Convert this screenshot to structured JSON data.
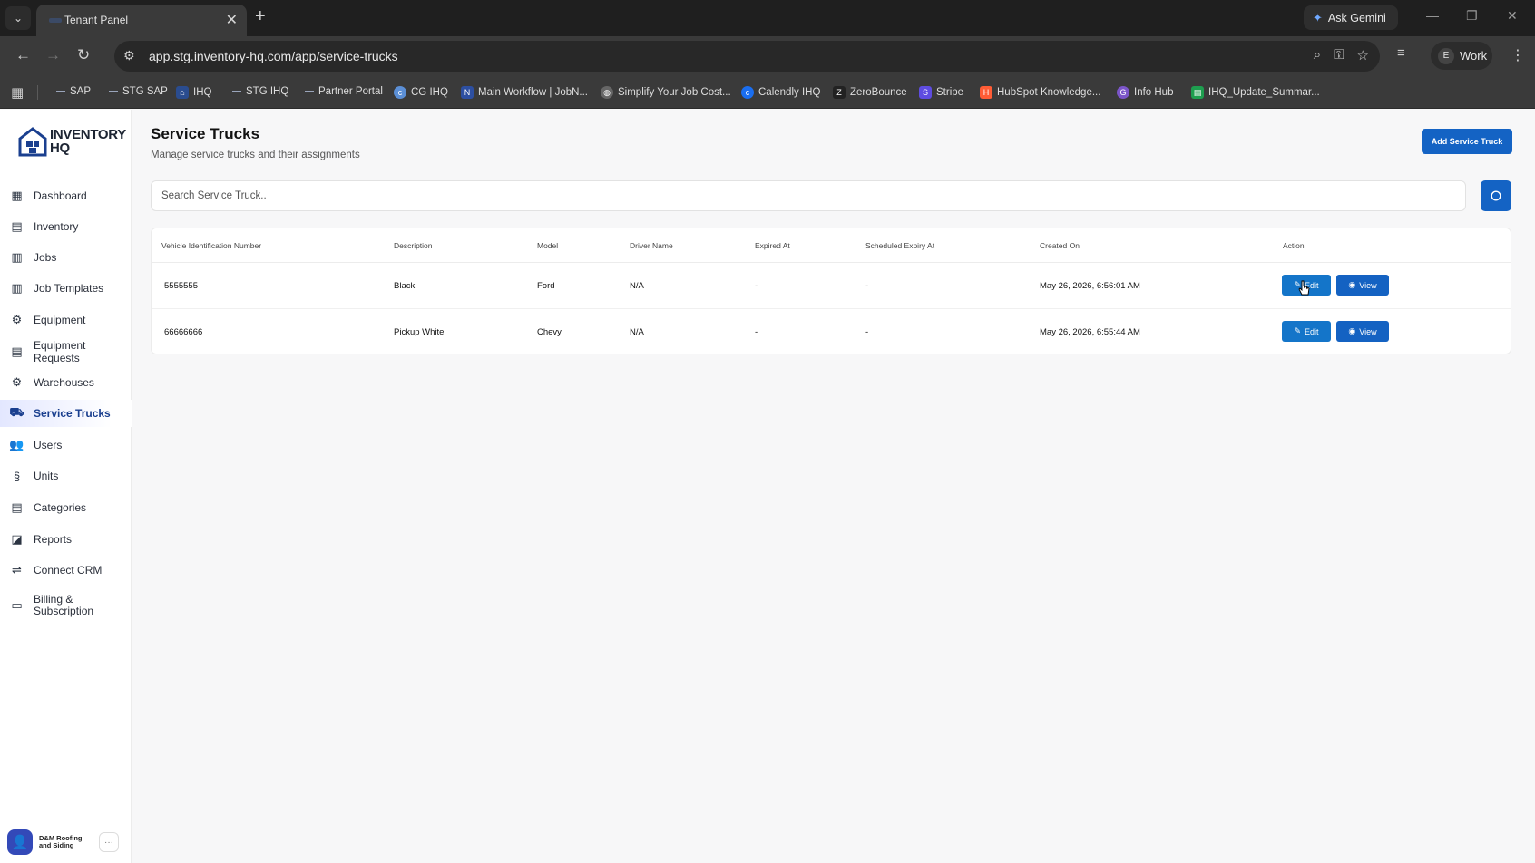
{
  "browser": {
    "tab_title": "Tenant Panel",
    "url": "app.stg.inventory-hq.com/app/service-trucks",
    "gemini_label": "Ask Gemini",
    "profile_initial": "E",
    "profile_label": "Work",
    "bookmarks": [
      {
        "label": "SAP",
        "icon": "dash"
      },
      {
        "label": "STG SAP",
        "icon": "dash"
      },
      {
        "label": "IHQ",
        "icon": "house"
      },
      {
        "label": "STG IHQ",
        "icon": "dash"
      },
      {
        "label": "Partner Portal",
        "icon": "dash"
      },
      {
        "label": "CG IHQ",
        "icon": "cg"
      },
      {
        "label": "Main Workflow | JobN...",
        "icon": "jobnimbus"
      },
      {
        "label": "Simplify Your Job Cost...",
        "icon": "globe"
      },
      {
        "label": "Calendly IHQ",
        "icon": "calendly"
      },
      {
        "label": "ZeroBounce",
        "icon": "zerobounce"
      },
      {
        "label": "Stripe",
        "icon": "stripe"
      },
      {
        "label": "HubSpot Knowledge...",
        "icon": "hubspot"
      },
      {
        "label": "Info Hub",
        "icon": "infohub"
      },
      {
        "label": "IHQ_Update_Summar...",
        "icon": "sheet"
      }
    ]
  },
  "brand": {
    "line1": "INVENTORY",
    "line2": "HQ",
    "accent": "#1a3f8f"
  },
  "sidebar": {
    "items": [
      {
        "label": "Dashboard",
        "icon": "dashboard-icon"
      },
      {
        "label": "Inventory",
        "icon": "inventory-icon"
      },
      {
        "label": "Jobs",
        "icon": "jobs-icon"
      },
      {
        "label": "Job Templates",
        "icon": "job-templates-icon"
      },
      {
        "label": "Equipment",
        "icon": "equipment-icon"
      },
      {
        "label": "Equipment Requests",
        "icon": "equipment-requests-icon"
      },
      {
        "label": "Warehouses",
        "icon": "warehouses-icon"
      },
      {
        "label": "Service Trucks",
        "icon": "truck-icon",
        "active": true
      },
      {
        "label": "Users",
        "icon": "users-icon"
      },
      {
        "label": "Units",
        "icon": "units-icon"
      },
      {
        "label": "Categories",
        "icon": "categories-icon"
      },
      {
        "label": "Reports",
        "icon": "reports-icon"
      },
      {
        "label": "Connect CRM",
        "icon": "crm-icon"
      },
      {
        "label": "Billing & Subscription",
        "icon": "billing-icon"
      }
    ],
    "org_name": "D&M Roofing and Siding"
  },
  "page": {
    "title": "Service Trucks",
    "subtitle": "Manage service trucks and their assignments",
    "add_button": "Add Service Truck",
    "search_placeholder": "Search Service Truck.."
  },
  "table": {
    "columns": [
      "Vehicle Identification Number",
      "Description",
      "Model",
      "Driver Name",
      "Expired At",
      "Scheduled Expiry At",
      "Created On",
      "Action"
    ],
    "rows": [
      {
        "vin": "5555555",
        "description": "Black",
        "model": "Ford",
        "driver": "N/A",
        "expired": "-",
        "scheduled": "-",
        "created": "May 26, 2026, 6:56:01 AM"
      },
      {
        "vin": "66666666",
        "description": "Pickup White",
        "model": "Chevy",
        "driver": "N/A",
        "expired": "-",
        "scheduled": "-",
        "created": "May 26, 2026, 6:55:44 AM"
      }
    ],
    "edit_label": "Edit",
    "view_label": "View"
  },
  "colors": {
    "primary": "#1463c4",
    "edit": "#1475c9",
    "active_nav_bg": "#e3e7ff"
  }
}
